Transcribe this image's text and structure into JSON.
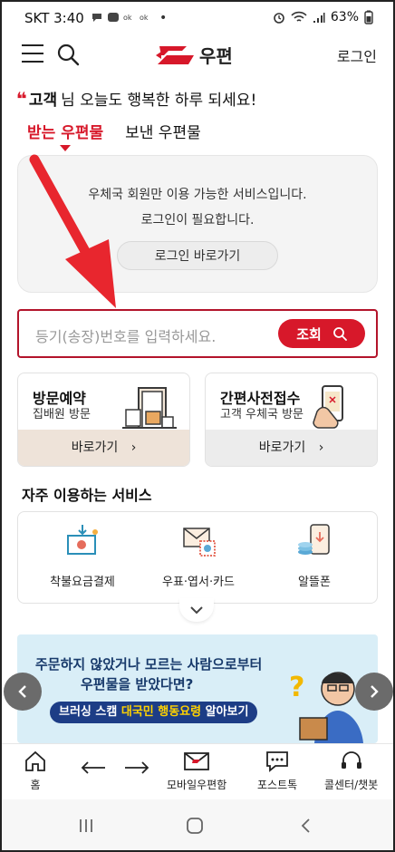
{
  "status_bar": {
    "carrier_time": "SKT 3:40",
    "battery": "63%"
  },
  "header": {
    "logo_text": "우편",
    "login": "로그인"
  },
  "greeting": {
    "quote": "❛❛",
    "name": "고객",
    "message": "님 오늘도 행복한 하루 되세요!"
  },
  "tabs": [
    {
      "label": "받는 우편물",
      "active": true
    },
    {
      "label": "보낸 우편물",
      "active": false
    }
  ],
  "notice": {
    "line1": "우체국 회원만 이용 가능한 서비스입니다.",
    "line2": "로그인이 필요합니다.",
    "button": "로그인 바로가기"
  },
  "tracking": {
    "placeholder": "등기(송장)번호를 입력하세요.",
    "button": "조회"
  },
  "cards": [
    {
      "title": "방문예약",
      "subtitle": "집배원 방문",
      "action": "바로가기"
    },
    {
      "title": "간편사전접수",
      "subtitle": "고객 우체국 방문",
      "action": "바로가기"
    }
  ],
  "frequent": {
    "title": "자주 이용하는 서비스",
    "items": [
      {
        "label": "착불요금결제"
      },
      {
        "label": "우표·엽서·카드"
      },
      {
        "label": "알뜰폰"
      }
    ]
  },
  "banner": {
    "line1": "주문하지 않았거나 모르는 사람으로부터",
    "line2": "우편물을 받았다면?",
    "pill_a": "브러싱 스캠 ",
    "pill_b": "대국민 행동요령",
    "pill_c": " 알아보기"
  },
  "bottom_nav": [
    {
      "label": "홈"
    },
    {
      "label": ""
    },
    {
      "label": ""
    },
    {
      "label": "모바일우편함"
    },
    {
      "label": "포스트톡"
    },
    {
      "label": "콜센터/챗봇"
    }
  ],
  "colors": {
    "accent": "#d7182a",
    "banner_bg": "#d9eef7",
    "navy": "#1d3d86"
  }
}
